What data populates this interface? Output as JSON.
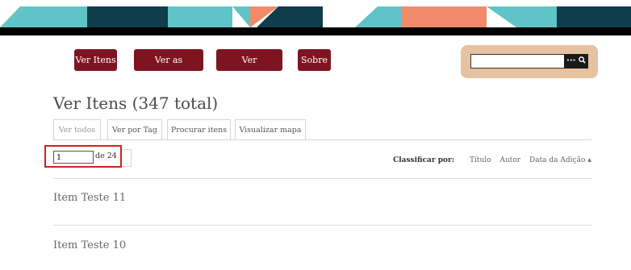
{
  "banner": {
    "colors": {
      "dark": "#0f3d4c",
      "teal": "#5fc4c7",
      "salmon": "#f08a6a",
      "black": "#000000"
    }
  },
  "nav": {
    "items": [
      {
        "label": "Ver Itens"
      },
      {
        "label": "Ver as Coleções"
      },
      {
        "label": "Ver Exposições"
      },
      {
        "label": "Sobre"
      }
    ]
  },
  "search": {
    "value": "",
    "button_label": "··· Q"
  },
  "page": {
    "title": "Ver Itens (347 total)"
  },
  "tabs": [
    {
      "label": "Ver todos",
      "active": true
    },
    {
      "label": "Ver por Tag",
      "active": false
    },
    {
      "label": "Procurar itens",
      "active": false
    },
    {
      "label": "Visualizar mapa",
      "active": false
    }
  ],
  "pagination": {
    "current": "1",
    "of_text": "de 24"
  },
  "sort": {
    "label": "Classificar por:",
    "options": [
      "Título",
      "Autor",
      "Data da Adição"
    ],
    "active_arrow": "▲"
  },
  "items": [
    {
      "title": "Item Teste 11"
    },
    {
      "title": "Item Teste 10"
    }
  ],
  "colors": {
    "accent": "#7e1420",
    "search_bg": "#e6c2a2",
    "highlight": "#d32020"
  }
}
